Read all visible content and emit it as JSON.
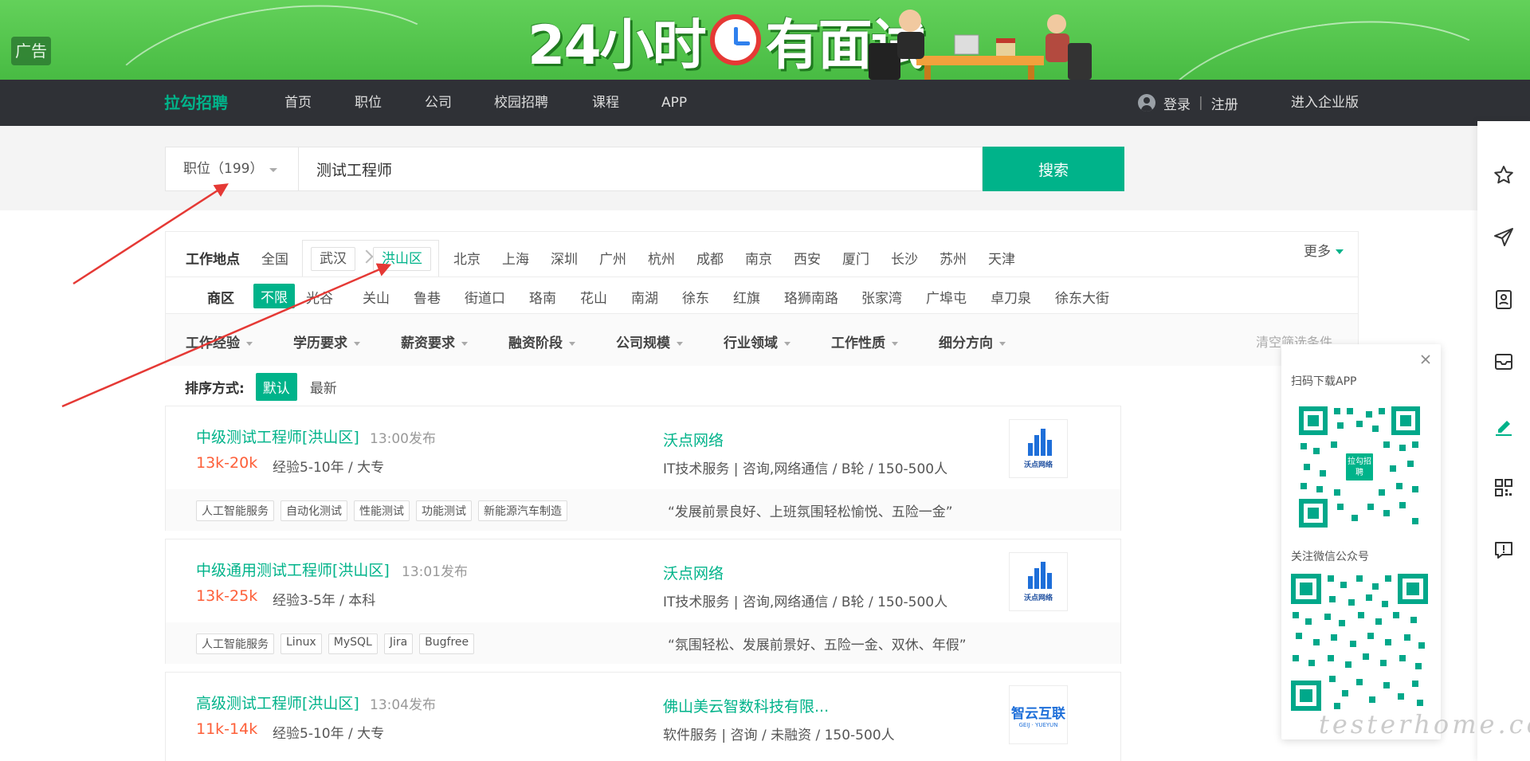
{
  "banner": {
    "ad_label": "广告",
    "headline_left": "24小时",
    "headline_right": "有面试"
  },
  "nav": {
    "logo": "拉勾招聘",
    "links": [
      "首页",
      "职位",
      "公司",
      "校园招聘",
      "课程",
      "APP"
    ],
    "login": "登录",
    "register": "注册",
    "enterprise": "进入企业版"
  },
  "search": {
    "type_label": "职位（199）",
    "query": "测试工程师",
    "button": "搜索"
  },
  "filters": {
    "location_label": "工作地点",
    "all_cities": "全国",
    "selected_city": "武汉",
    "selected_district": "洪山区",
    "cities": [
      "北京",
      "上海",
      "深圳",
      "广州",
      "杭州",
      "成都",
      "南京",
      "西安",
      "厦门",
      "长沙",
      "苏州",
      "天津"
    ],
    "more": "更多",
    "district_label": "商区",
    "districts": [
      "不限",
      "光谷",
      "关山",
      "鲁巷",
      "街道口",
      "珞南",
      "花山",
      "南湖",
      "徐东",
      "红旗",
      "珞狮南路",
      "张家湾",
      "广埠屯",
      "卓刀泉",
      "徐东大街"
    ],
    "conditions": [
      "工作经验",
      "学历要求",
      "薪资要求",
      "融资阶段",
      "公司规模",
      "行业领域",
      "工作性质",
      "细分方向"
    ],
    "clear": "清空筛选条件"
  },
  "sort": {
    "label": "排序方式:",
    "default": "默认",
    "latest": "最新"
  },
  "jobs": [
    {
      "title": "中级测试工程师[洪山区]",
      "time": "13:00发布",
      "salary": "13k-20k",
      "requirement": "经验5-10年 / 大专",
      "company": "沃点网络",
      "company_info": "IT技术服务 | 咨询,网络通信 / B轮 / 150-500人",
      "logo_text": "沃点网络",
      "tags": [
        "人工智能服务",
        "自动化测试",
        "性能测试",
        "功能测试",
        "新能源汽车制造"
      ],
      "slogan": "“发展前景良好、上班氛围轻松愉悦、五险一金”"
    },
    {
      "title": "中级通用测试工程师[洪山区]",
      "time": "13:01发布",
      "salary": "13k-25k",
      "requirement": "经验3-5年 / 本科",
      "company": "沃点网络",
      "company_info": "IT技术服务 | 咨询,网络通信 / B轮 / 150-500人",
      "logo_text": "沃点网络",
      "tags": [
        "人工智能服务",
        "Linux",
        "MySQL",
        "Jira",
        "Bugfree"
      ],
      "slogan": "“氛围轻松、发展前景好、五险一金、双休、年假”"
    },
    {
      "title": "高级测试工程师[洪山区]",
      "time": "13:04发布",
      "salary": "11k-14k",
      "requirement": "经验5-10年 / 大专",
      "company": "佛山美云智数科技有限...",
      "company_info": "软件服务 | 咨询 / 未融资 / 150-500人",
      "logo_text": "智云互联",
      "logo_sub": "GEIJ · YUEYUN"
    }
  ],
  "qr": {
    "app_title": "扫码下载APP",
    "app_badge": "拉勾招聘",
    "wechat_title": "关注微信公众号"
  },
  "watermark": "testerhome.com",
  "colors": {
    "brand": "#00b38a",
    "salary": "#fd5f39",
    "nav_bg": "#2f3136",
    "banner": "#52c74c"
  }
}
